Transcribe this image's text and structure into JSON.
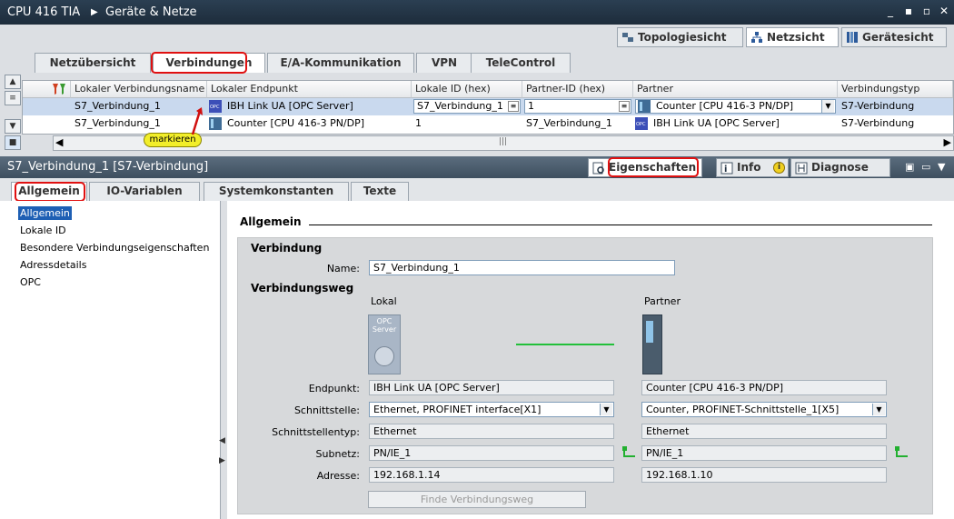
{
  "window": {
    "breadcrumb": [
      "CPU 416 TIA",
      "Geräte & Netze"
    ],
    "controls": [
      "_",
      "▪▪",
      "▫",
      "✕"
    ]
  },
  "view_tabs": [
    {
      "label": "Topologiesicht",
      "icon": "topology-icon"
    },
    {
      "label": "Netzsicht",
      "icon": "network-icon",
      "active": true
    },
    {
      "label": "Gerätesicht",
      "icon": "device-icon"
    }
  ],
  "editor_tabs": [
    "Netzübersicht",
    "Verbindungen",
    "E/A-Kommunikation",
    "VPN",
    "TeleControl"
  ],
  "table": {
    "headers": [
      "Lokaler Verbindungsname",
      "Lokaler Endpunkt",
      "Lokale ID (hex)",
      "Partner-ID (hex)",
      "Partner",
      "Verbindungstyp"
    ],
    "rows": [
      {
        "name": "S7_Verbindung_1",
        "endpoint": "IBH Link UA [OPC Server]",
        "local_id": "S7_Verbindung_1",
        "partner_id": "1",
        "partner": "Counter [CPU 416-3 PN/DP]",
        "type": "S7-Verbindung",
        "endpoint_icon": "opc-icon",
        "partner_icon": "cpu-icon"
      },
      {
        "name": "S7_Verbindung_1",
        "endpoint": "Counter [CPU 416-3 PN/DP]",
        "local_id": "1",
        "partner_id": "S7_Verbindung_1",
        "partner": "IBH Link UA [OPC Server]",
        "type": "S7-Verbindung",
        "endpoint_icon": "cpu-icon",
        "partner_icon": "opc-icon"
      }
    ],
    "callout": "markieren"
  },
  "inspector": {
    "title": "S7_Verbindung_1 [S7-Verbindung]",
    "tabs": [
      "Eigenschaften",
      "Info",
      "Diagnose"
    ],
    "info_badge": "i"
  },
  "sub_tabs": [
    "Allgemein",
    "IO-Variablen",
    "Systemkonstanten",
    "Texte"
  ],
  "nav": [
    "Allgemein",
    "Lokale ID",
    "Besondere Verbindungseigenschaften",
    "Adressdetails",
    "OPC"
  ],
  "section": {
    "heading": "Allgemein",
    "verbindung": "Verbindung",
    "name_label": "Name:",
    "name_value": "S7_Verbindung_1",
    "weg": "Verbindungsweg",
    "lokal": "Lokal",
    "partner": "Partner",
    "opc_line1": "OPC",
    "opc_line2": "Server",
    "rows": [
      {
        "label": "Endpunkt:",
        "local": "IBH Link UA [OPC Server]",
        "partner": "Counter [CPU 416-3 PN/DP]"
      },
      {
        "label": "Schnittstelle:",
        "local": "Ethernet, PROFINET interface[X1]",
        "partner": "Counter, PROFINET-Schnittstelle_1[X5]"
      },
      {
        "label": "Schnittstellentyp:",
        "local": "Ethernet",
        "partner": "Ethernet"
      },
      {
        "label": "Subnetz:",
        "local": "PN/IE_1",
        "partner": "PN/IE_1"
      },
      {
        "label": "Adresse:",
        "local": "192.168.1.14",
        "partner": "192.168.1.10"
      }
    ],
    "find_button": "Finde Verbindungsweg"
  }
}
